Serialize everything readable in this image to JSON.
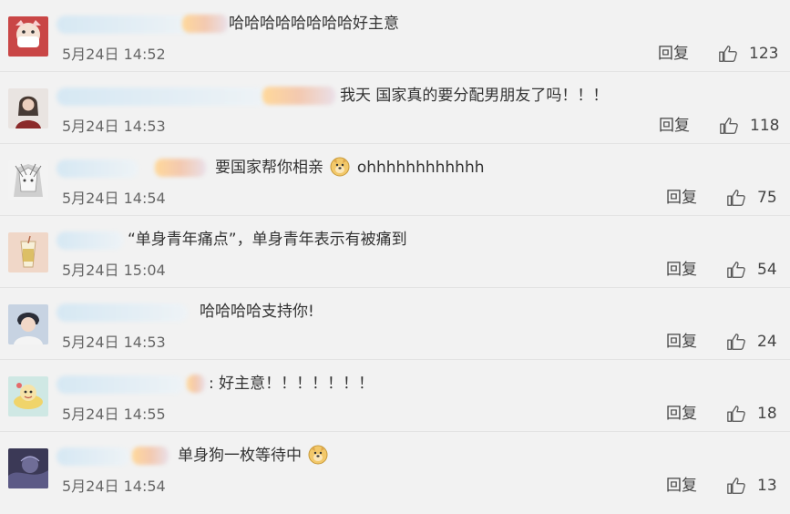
{
  "comments": [
    {
      "avatar_icon": "mask-avatar-icon",
      "content": "哈哈哈哈哈哈哈哈好主意",
      "time": "5月24日 14:52",
      "reply": "回复",
      "likes": "123"
    },
    {
      "avatar_icon": "girl-avatar-icon",
      "content": "我天 国家真的要分配男朋友了吗！！！",
      "time": "5月24日 14:53",
      "reply": "回复",
      "likes": "118"
    },
    {
      "avatar_icon": "anime-avatar-icon",
      "content": "要国家帮你相亲",
      "content_tail": "ohhhhhhhhhhhh",
      "time": "5月24日 14:54",
      "reply": "回复",
      "likes": "75"
    },
    {
      "avatar_icon": "drink-avatar-icon",
      "content": "“单身青年痛点”，单身青年表示有被痛到",
      "time": "5月24日 15:04",
      "reply": "回复",
      "likes": "54"
    },
    {
      "avatar_icon": "boy-avatar-icon",
      "content": "哈哈哈哈支持你!",
      "time": "5月24日 14:53",
      "reply": "回复",
      "likes": "24"
    },
    {
      "avatar_icon": "cartoon-avatar-icon",
      "content": "好主意！！！！！！！",
      "time": "5月24日 14:55",
      "reply": "回复",
      "likes": "18"
    },
    {
      "avatar_icon": "dark-avatar-icon",
      "content": "单身狗一枚等待中",
      "time": "5月24日 14:54",
      "reply": "回复",
      "likes": "13"
    }
  ],
  "colors": {
    "background": "#f2f2f2",
    "text": "#333333",
    "meta": "#666666",
    "divider": "#e3e3e3"
  }
}
